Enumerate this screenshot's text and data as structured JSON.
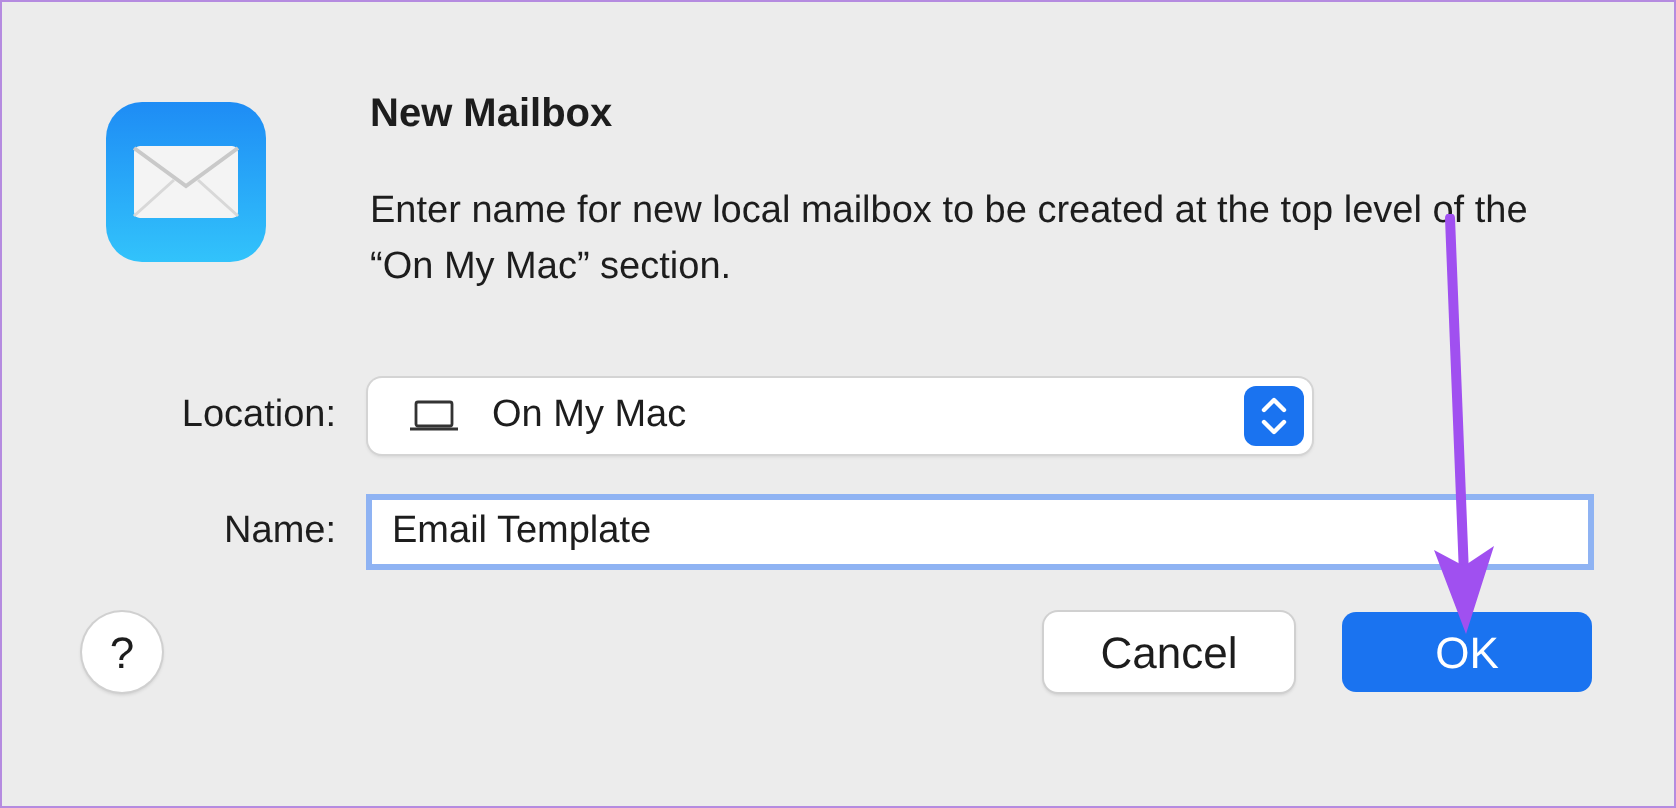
{
  "dialog": {
    "title": "New Mailbox",
    "message": "Enter name for new local mailbox to be created at the top level of the “On My Mac” section.",
    "location": {
      "label": "Location:",
      "value": "On My Mac"
    },
    "name": {
      "label": "Name:",
      "value": "Email Template",
      "focused": true
    },
    "help": "?",
    "buttons": [
      {
        "label": "Cancel",
        "kind": "secondary"
      },
      {
        "label": "OK",
        "kind": "primary"
      }
    ]
  }
}
